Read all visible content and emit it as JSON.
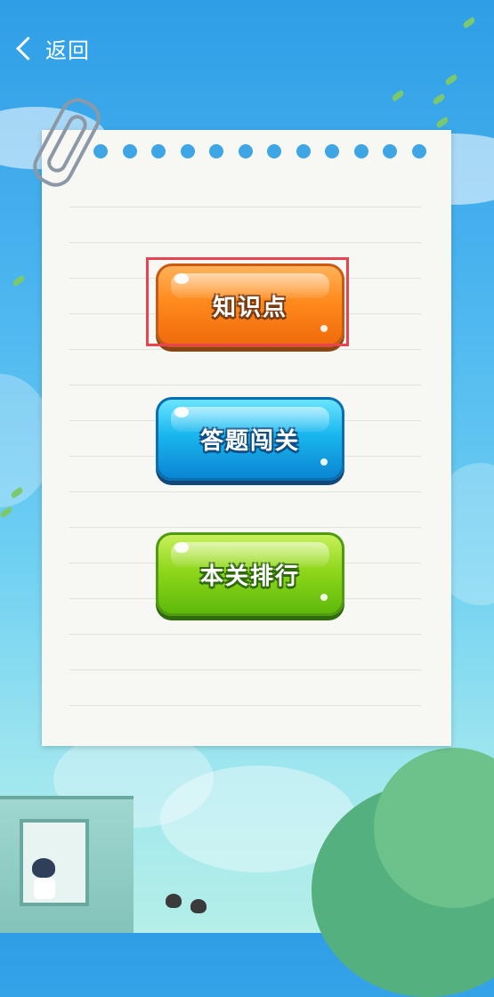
{
  "header": {
    "back_label": "返回"
  },
  "menu": {
    "buttons": [
      {
        "label": "知识点"
      },
      {
        "label": "答题闯关"
      },
      {
        "label": "本关排行"
      }
    ]
  },
  "colors": {
    "sky": "#2f9ee6",
    "paper": "#f7f7f4",
    "hole": "#3fa6e6",
    "orange_button": "#ff8a1c",
    "blue_button": "#19b6ee",
    "green_button": "#8fd71c",
    "highlight_border": "#e8434e"
  },
  "icons": {
    "back": "chevron-left-icon",
    "paperclip": "paperclip-icon"
  }
}
